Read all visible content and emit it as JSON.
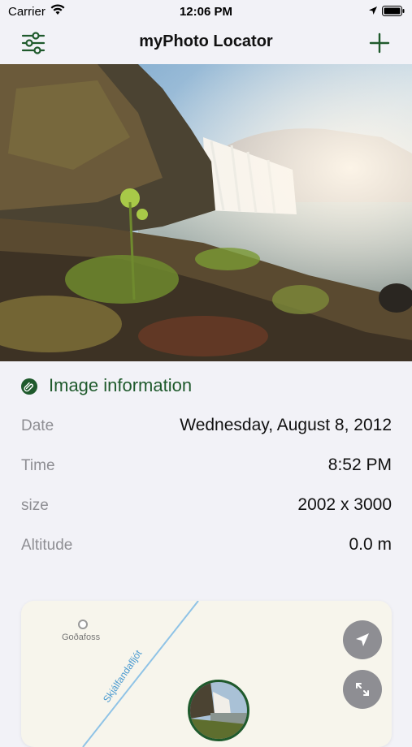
{
  "status_bar": {
    "carrier": "Carrier",
    "time": "12:06 PM",
    "icons": [
      "wifi-icon",
      "location-arrow-icon",
      "battery-icon"
    ]
  },
  "nav": {
    "title": "myPhoto Locator",
    "left_icon": "sliders-icon",
    "right_icon": "plus-icon"
  },
  "photo": {
    "subject": "waterfall-photo"
  },
  "info": {
    "title": "Image information",
    "icon": "paperclip-badge-icon",
    "rows": [
      {
        "label": "Date",
        "value": "Wednesday, August 8, 2012"
      },
      {
        "label": "Time",
        "value": "8:52 PM"
      },
      {
        "label": "size",
        "value": "2002 x 3000"
      },
      {
        "label": "Altitude",
        "value": "0.0 m"
      }
    ]
  },
  "map": {
    "poi_label": "Goðafoss",
    "river_label": "Skjálfandafljót",
    "buttons": [
      "location-arrow-icon",
      "expand-icon"
    ]
  },
  "colors": {
    "accent": "#1f5a2c",
    "background": "#f2f2f7",
    "label_gray": "#8e8e93",
    "map_bg": "#f7f5ec",
    "river": "#4a9ad0"
  }
}
